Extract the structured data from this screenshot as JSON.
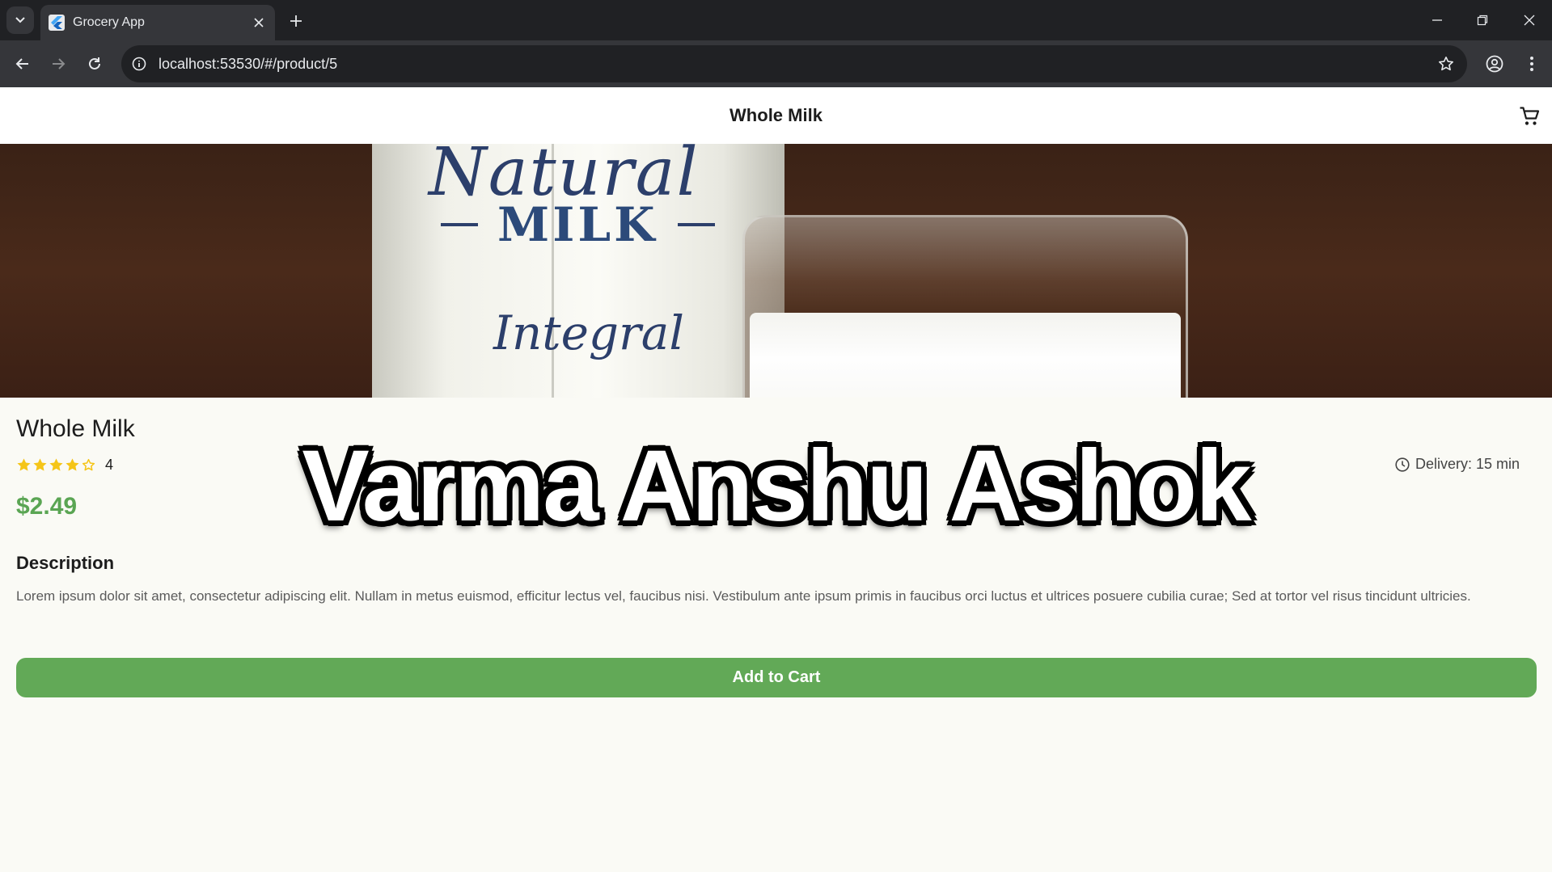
{
  "browser": {
    "tab_title": "Grocery App",
    "url": "localhost:53530/#/product/5"
  },
  "app": {
    "title": "Whole Milk"
  },
  "hero_image": {
    "carton_text_top": "Natural",
    "carton_text_middle": "MILK",
    "carton_text_bottom": "Integral"
  },
  "product": {
    "name": "Whole Milk",
    "rating": "4",
    "stars_filled": 4,
    "stars_total": 5,
    "delivery": "Delivery: 15 min",
    "price": "$2.49",
    "description_heading": "Description",
    "description": "Lorem ipsum dolor sit amet, consectetur adipiscing elit. Nullam in metus euismod, efficitur lectus vel, faucibus nisi. Vestibulum ante ipsum primis in faucibus orci luctus et ultrices posuere cubilia curae; Sed at tortor vel risus tincidunt ultricies.",
    "add_to_cart_label": "Add to Cart"
  },
  "overlay": {
    "watermark_text": "Varma Anshu Ashok"
  },
  "colors": {
    "accent_green": "#62a957",
    "price_green": "#5aa553",
    "star_yellow": "#f5c518"
  }
}
